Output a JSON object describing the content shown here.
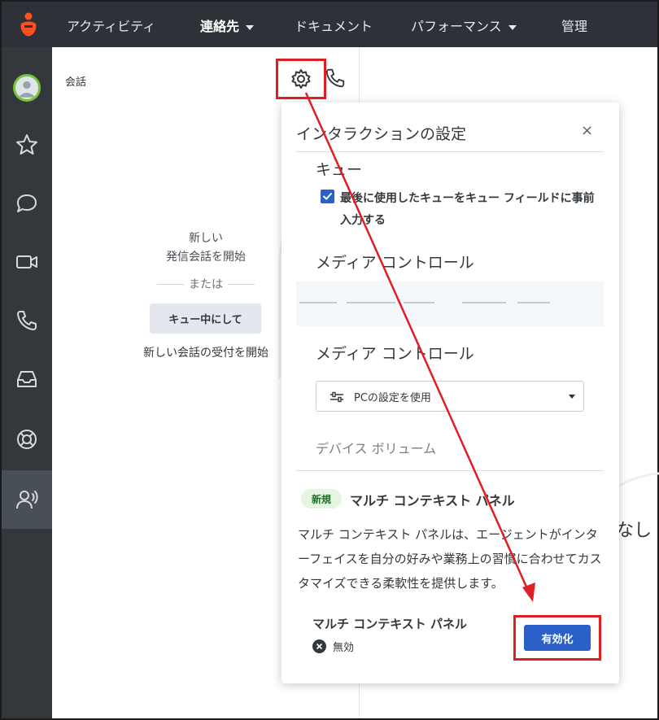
{
  "topnav": {
    "items": [
      {
        "label": "アクティビティ",
        "has_caret": false,
        "bold": false
      },
      {
        "label": "連絡先",
        "has_caret": true,
        "bold": true
      },
      {
        "label": "ドキュメント",
        "has_caret": false,
        "bold": false
      },
      {
        "label": "パフォーマンス",
        "has_caret": true,
        "bold": false
      },
      {
        "label": "管理",
        "has_caret": false,
        "bold": false
      }
    ]
  },
  "rail": {
    "icons": [
      "avatar",
      "star-icon",
      "chat-bubble-icon",
      "video-icon",
      "phone-icon",
      "inbox-icon",
      "lifebuoy-icon",
      "agent-voice-icon"
    ],
    "active_index": 7
  },
  "conversation": {
    "title": "会話",
    "empty_line1": "新しい",
    "empty_line2": "発信会話を開始",
    "or_label": "または",
    "queue_button": "キュー中にして",
    "start_text": "新しい会話の受付を開始"
  },
  "background_text": "なし",
  "settings": {
    "title": "インタラクションの設定",
    "close": "×",
    "queue_section": "キュー",
    "prefill_checkbox_label": "最後に使用したキューをキュー フィールドに事前入力する",
    "prefill_checked": true,
    "media_control_1": "メディア コントロール",
    "media_control_2": "メディア コントロール",
    "media_select_value": "PCの設定を使用",
    "device_volume": "デバイス ボリューム",
    "new_badge": "新規",
    "multi_context_title": "マルチ コンテキスト パネル",
    "multi_context_desc": "マルチ コンテキスト パネルは、エージェントがインターフェイスを自分の好みや業務上の習慣に合わせてカスタマイズできる柔軟性を提供します。",
    "multi_context_name": "マルチ コンテキスト パネル",
    "status": "無効",
    "enable_button": "有効化"
  },
  "colors": {
    "nav_bg": "#2e3238",
    "rail_bg": "#33383d",
    "accent_blue": "#2a60c8",
    "highlight_red": "#e01e24",
    "logo_orange": "#ff4f1f",
    "badge_green": "#e4f5e0"
  }
}
